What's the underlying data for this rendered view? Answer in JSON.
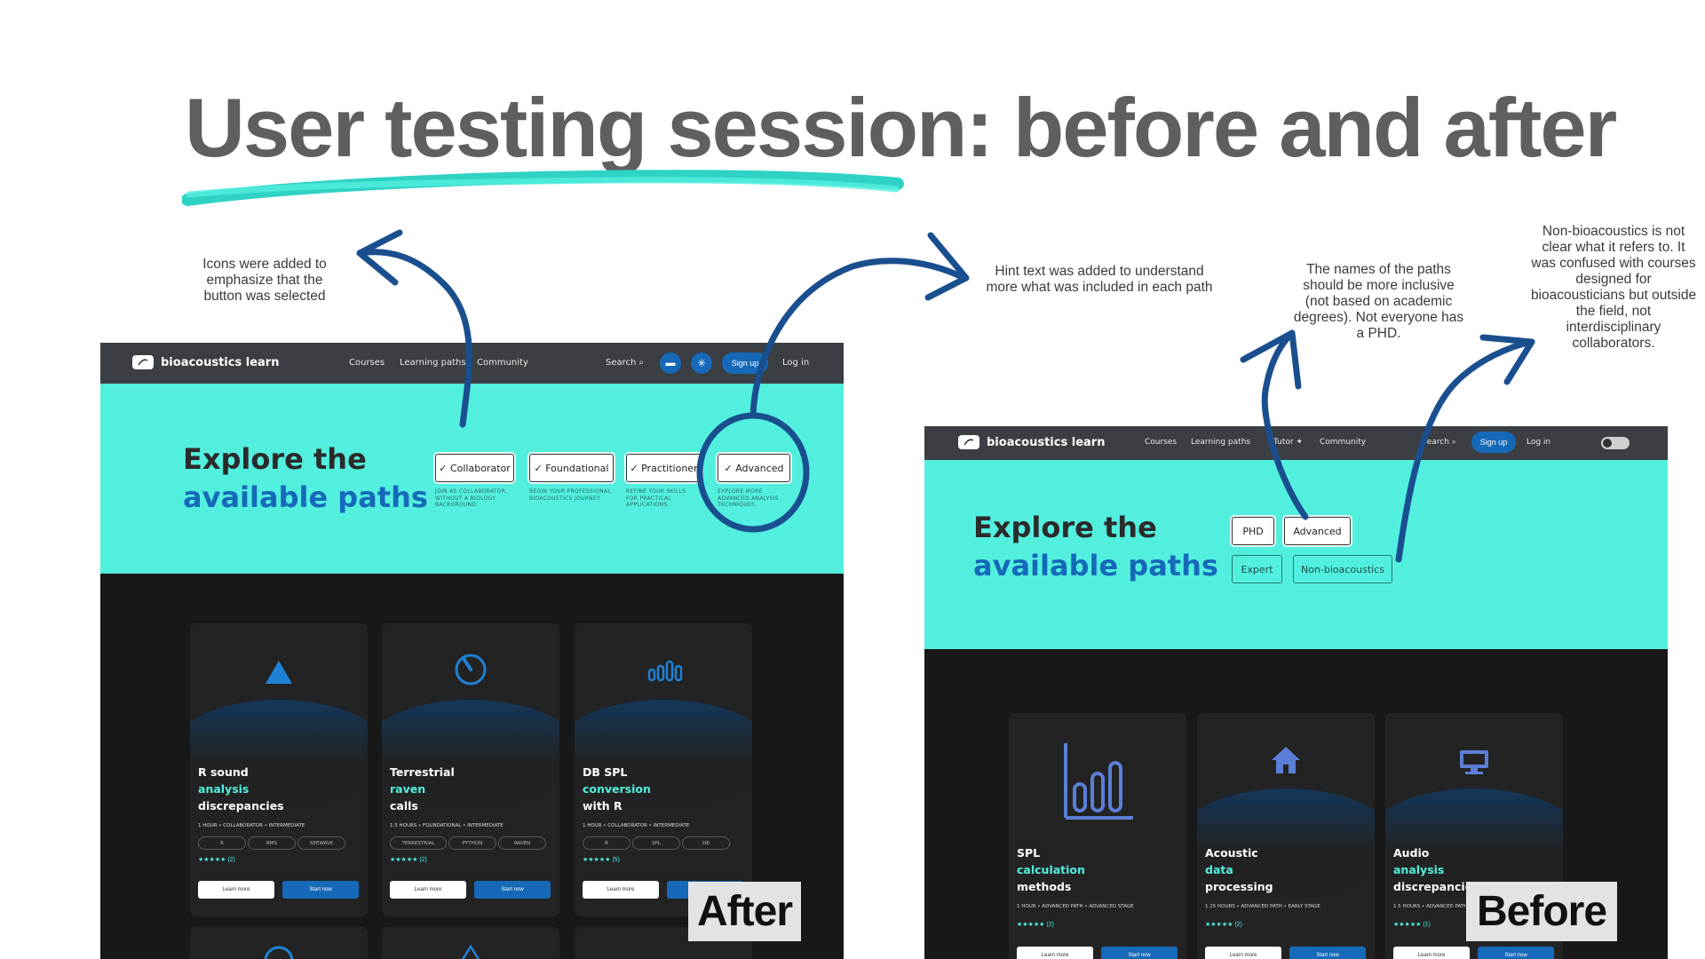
{
  "title": "User testing session: before and after",
  "notes": {
    "icons": "Icons were added to emphasize that the button was selected",
    "hint": "Hint text was added to understand more what was included in each path",
    "names": "The names of the paths should be more inclusive (not based on academic degrees). Not everyone has a PHD.",
    "nonbio": "Non-bioacoustics is not clear what it refers to. It was confused with courses designed for bioacousticians but outside the field, not interdisciplinary collaborators."
  },
  "after": {
    "stamp": "After",
    "logo": "bioacoustics learn",
    "nav": {
      "courses": "Courses",
      "paths": "Learning paths",
      "community": "Community",
      "search": "Search",
      "signup": "Sign up",
      "login": "Log in"
    },
    "hero": {
      "line1": "Explore the",
      "line2": "available paths"
    },
    "paths": [
      {
        "label": "Collaborator",
        "hint": "Join as collaborator, without a biology background."
      },
      {
        "label": "Foundational",
        "hint": "Begin your professional bioacoustics journey."
      },
      {
        "label": "Practitioner",
        "hint": "Refine your skills for practical applications."
      },
      {
        "label": "Advanced",
        "hint": "Explore more advanced analysis techniques."
      }
    ],
    "cards": [
      {
        "w1": "R sound",
        "c": "analysis",
        "w2": "discrepancies",
        "meta": "1 HOUR • COLLABORATOR • INTERMEDIATE",
        "tags": [
          "R",
          "RMS",
          "SEEWAVE"
        ],
        "rating": "★★★★★ (2)",
        "learn": "Learn more",
        "start": "Start now"
      },
      {
        "w1": "Terrestrial",
        "c": "raven",
        "w2": "calls",
        "meta": "1.5 HOURS • FOUNDATIONAL • INTERMEDIATE",
        "tags": [
          "TERRESTRIAL",
          "PYTHON",
          "RAVEN"
        ],
        "rating": "★★★★★ (2)",
        "learn": "Learn more",
        "start": "Start now"
      },
      {
        "w1": "DB SPL",
        "c": "conversion",
        "w2": "with R",
        "meta": "1 HOUR • COLLABORATOR • INTERMEDIATE",
        "tags": [
          "R",
          "SPL",
          "DB"
        ],
        "rating": "★★★★★ (5)",
        "learn": "Learn more",
        "start": "Start now"
      }
    ]
  },
  "before": {
    "stamp": "Before",
    "logo": "bioacoustics learn",
    "nav": {
      "courses": "Courses",
      "paths": "Learning paths",
      "tutor": "Tutor",
      "community": "Community",
      "search": "Search",
      "signup": "Sign up",
      "login": "Log in"
    },
    "hero": {
      "line1": "Explore the",
      "line2": "available paths"
    },
    "paths": [
      "PHD",
      "Advanced",
      "Expert",
      "Non-bioacoustics"
    ],
    "cards": [
      {
        "w1": "SPL",
        "c": "calculation",
        "w2": "methods",
        "meta": "1 HOUR • ADVANCED PATH • ADVANCED STAGE",
        "rating": "★★★★★ (2)",
        "learn": "Learn more",
        "start": "Start now"
      },
      {
        "w1": "Acoustic",
        "c": "data",
        "w2": "processing",
        "meta": "1.15 HOURS • ADVANCED PATH • EARLY STAGE",
        "rating": "★★★★★ (2)",
        "learn": "Learn more",
        "start": "Start now"
      },
      {
        "w1": "Audio",
        "c": "analysis",
        "w2": "discrepancies",
        "meta": "1.5 HOURS • ADVANCED PATH",
        "rating": "★★★★★ (1)",
        "learn": "Learn more",
        "start": "Start now"
      }
    ]
  },
  "colors": {
    "accent_teal": "#52efdf",
    "brand_blue": "#1669b8",
    "annotation_blue": "#1a4f8f",
    "title_gray": "#5f5f5f"
  }
}
